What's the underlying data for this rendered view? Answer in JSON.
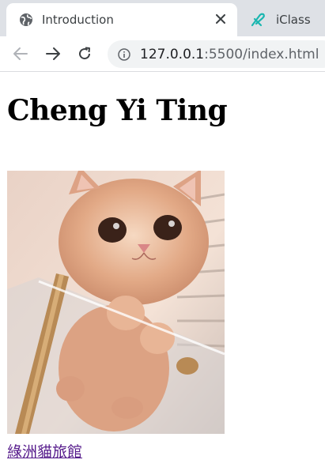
{
  "browser": {
    "tabs": [
      {
        "title": "Introduction",
        "active": true,
        "icon": "globe-icon"
      },
      {
        "title": "iClass",
        "active": false,
        "icon": "iclass-logo-icon"
      }
    ],
    "address": {
      "host": "127.0.0.1",
      "path": ":5500/index.html"
    }
  },
  "page": {
    "heading": "Cheng Yi Ting",
    "image": {
      "subject": "kitten photo"
    },
    "link_text": "綠洲貓旅館"
  },
  "colors": {
    "tabstrip": "#dee1e6",
    "link_visited": "#551a8b",
    "omnibox": "#f1f3f4"
  }
}
